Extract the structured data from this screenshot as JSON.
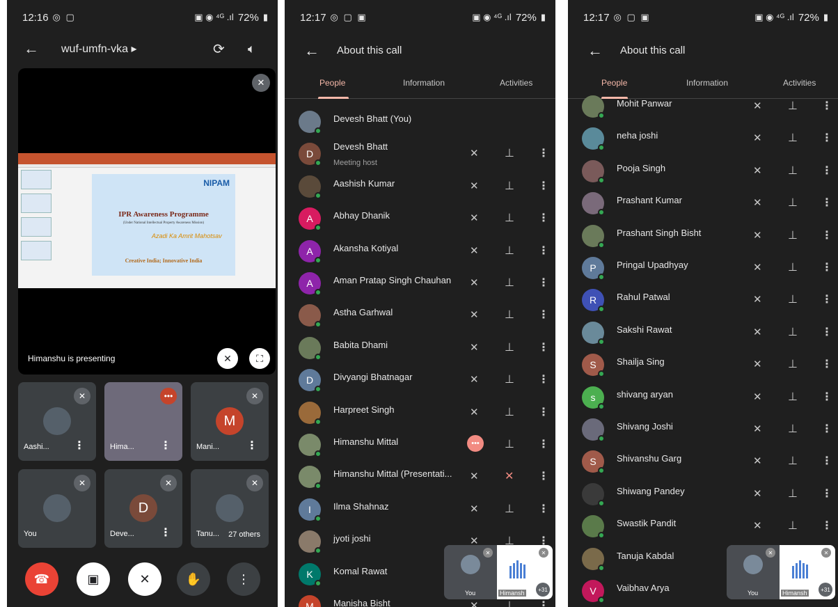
{
  "status": {
    "p1": {
      "time": "12:16",
      "battery": "72%"
    },
    "p2": {
      "time": "12:17",
      "battery": "72%"
    },
    "p3": {
      "time": "12:17",
      "battery": "72%"
    }
  },
  "call": {
    "code": "wuf-umfn-vka",
    "presenting_label": "Himanshu is presenting",
    "slide": {
      "brand": "NIPAM",
      "title": "IPR Awareness Programme",
      "subtitle": "(Under National Intellectual Property Awareness Mission)",
      "tagline": "Creative India; Innovative India",
      "emblem_text": "Azadi Ka Amrit Mahotsav"
    },
    "tiles": [
      {
        "name": "Aashi...",
        "avatar": "photo"
      },
      {
        "name": "Hima...",
        "avatar": "video"
      },
      {
        "name": "Mani...",
        "avatar": "M",
        "color": "#c5442b"
      },
      {
        "name": "You",
        "avatar": "photo"
      },
      {
        "name": "Deve...",
        "avatar": "D",
        "color": "#7a4a3a"
      },
      {
        "name": "Tanu...",
        "avatar": "photo",
        "others": "27 others"
      }
    ]
  },
  "about": {
    "title": "About this call",
    "tabs": [
      "People",
      "Information",
      "Activities"
    ]
  },
  "people_p2": [
    {
      "name": "Devesh Bhatt (You)",
      "avatar": "photo",
      "color": "#6b7a8a",
      "you": true
    },
    {
      "name": "Devesh Bhatt",
      "sub": "Meeting host",
      "avatar": "D",
      "color": "#7a4a3a"
    },
    {
      "name": "Aashish Kumar",
      "avatar": "photo",
      "color": "#5a4a3a"
    },
    {
      "name": "Abhay Dhanik",
      "avatar": "A",
      "color": "#d81b60"
    },
    {
      "name": "Akansha Kotiyal",
      "avatar": "A",
      "color": "#8e24aa"
    },
    {
      "name": "Aman Pratap Singh Chauhan",
      "avatar": "A",
      "color": "#8e24aa"
    },
    {
      "name": "Astha Garhwal",
      "avatar": "photo",
      "color": "#8a5a4a"
    },
    {
      "name": "Babita Dhami",
      "avatar": "photo",
      "color": "#6a7a5a"
    },
    {
      "name": "Divyangi Bhatnagar",
      "avatar": "D",
      "color": "#5f7a9a"
    },
    {
      "name": "Harpreet Singh",
      "avatar": "photo",
      "color": "#9a6a3a"
    },
    {
      "name": "Himanshu Mittal",
      "avatar": "photo",
      "color": "#7a8a6a",
      "speaking": true
    },
    {
      "name": "Himanshu Mittal (Presentati...",
      "avatar": "photo",
      "color": "#7a8a6a",
      "pinned_off": true
    },
    {
      "name": "Ilma Shahnaz",
      "avatar": "I",
      "color": "#5f7a9a"
    },
    {
      "name": "jyoti joshi",
      "avatar": "photo",
      "color": "#8a7a6a"
    },
    {
      "name": "Komal Rawat",
      "avatar": "K",
      "color": "#00796b"
    },
    {
      "name": "Manisha Bisht",
      "avatar": "M",
      "color": "#c5442b"
    }
  ],
  "people_p3": [
    {
      "name": "Mohit Panwar",
      "avatar": "photo",
      "color": "#6a7a5a"
    },
    {
      "name": "neha joshi",
      "avatar": "photo",
      "color": "#5a8a9a"
    },
    {
      "name": "Pooja Singh",
      "avatar": "photo",
      "color": "#7a5a5a"
    },
    {
      "name": "Prashant Kumar",
      "avatar": "photo",
      "color": "#7a6a7a"
    },
    {
      "name": "Prashant Singh Bisht",
      "avatar": "photo",
      "color": "#6a7a5a"
    },
    {
      "name": "Pringal Upadhyay",
      "avatar": "P",
      "color": "#5f7a9a"
    },
    {
      "name": "Rahul Patwal",
      "avatar": "R",
      "color": "#3f51b5"
    },
    {
      "name": "Sakshi Rawat",
      "avatar": "photo",
      "color": "#6a8a9a"
    },
    {
      "name": "Shailja Sing",
      "avatar": "S",
      "color": "#a05a4a"
    },
    {
      "name": "shivang aryan",
      "avatar": "s",
      "color": "#4caf50"
    },
    {
      "name": "Shivang Joshi",
      "avatar": "photo",
      "color": "#6a6a7a"
    },
    {
      "name": "Shivanshu Garg",
      "avatar": "S",
      "color": "#a05a4a"
    },
    {
      "name": "Shiwang Pandey",
      "avatar": "photo",
      "color": "#3a3a3a"
    },
    {
      "name": "Swastik Pandit",
      "avatar": "photo",
      "color": "#5a7a4a"
    },
    {
      "name": "Tanuja Kabdal",
      "avatar": "photo",
      "color": "#7a6a4a"
    },
    {
      "name": "Vaibhav Arya",
      "avatar": "V",
      "color": "#c2185b"
    }
  ],
  "pip": {
    "you_label": "You",
    "other_label": "Himansh",
    "extra": "+31"
  }
}
